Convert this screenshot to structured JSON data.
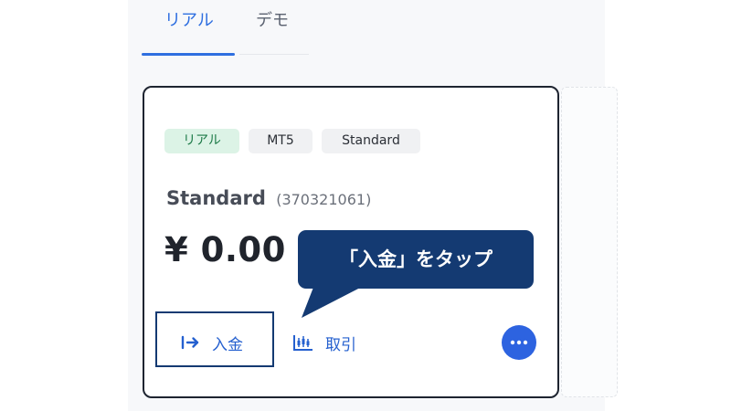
{
  "tabs": [
    {
      "label": "リアル",
      "active": true
    },
    {
      "label": "デモ",
      "active": false
    }
  ],
  "account": {
    "tags": [
      "リアル",
      "MT5",
      "Standard"
    ],
    "name": "Standard",
    "number": "(370321061)",
    "balance": "¥ 0.00"
  },
  "actions": {
    "deposit_label": "入金",
    "trade_label": "取引"
  },
  "callout": {
    "text": "「入金」をタップ"
  },
  "colors": {
    "accent": "#2f6fe0",
    "callout_bg": "#143a72",
    "real_tag_bg": "#dcf3e6",
    "real_tag_text": "#1c7a47"
  },
  "icons": {
    "deposit": "arrow-right-bar-icon",
    "trade": "candlestick-chart-icon",
    "more": "more-horizontal-icon"
  }
}
